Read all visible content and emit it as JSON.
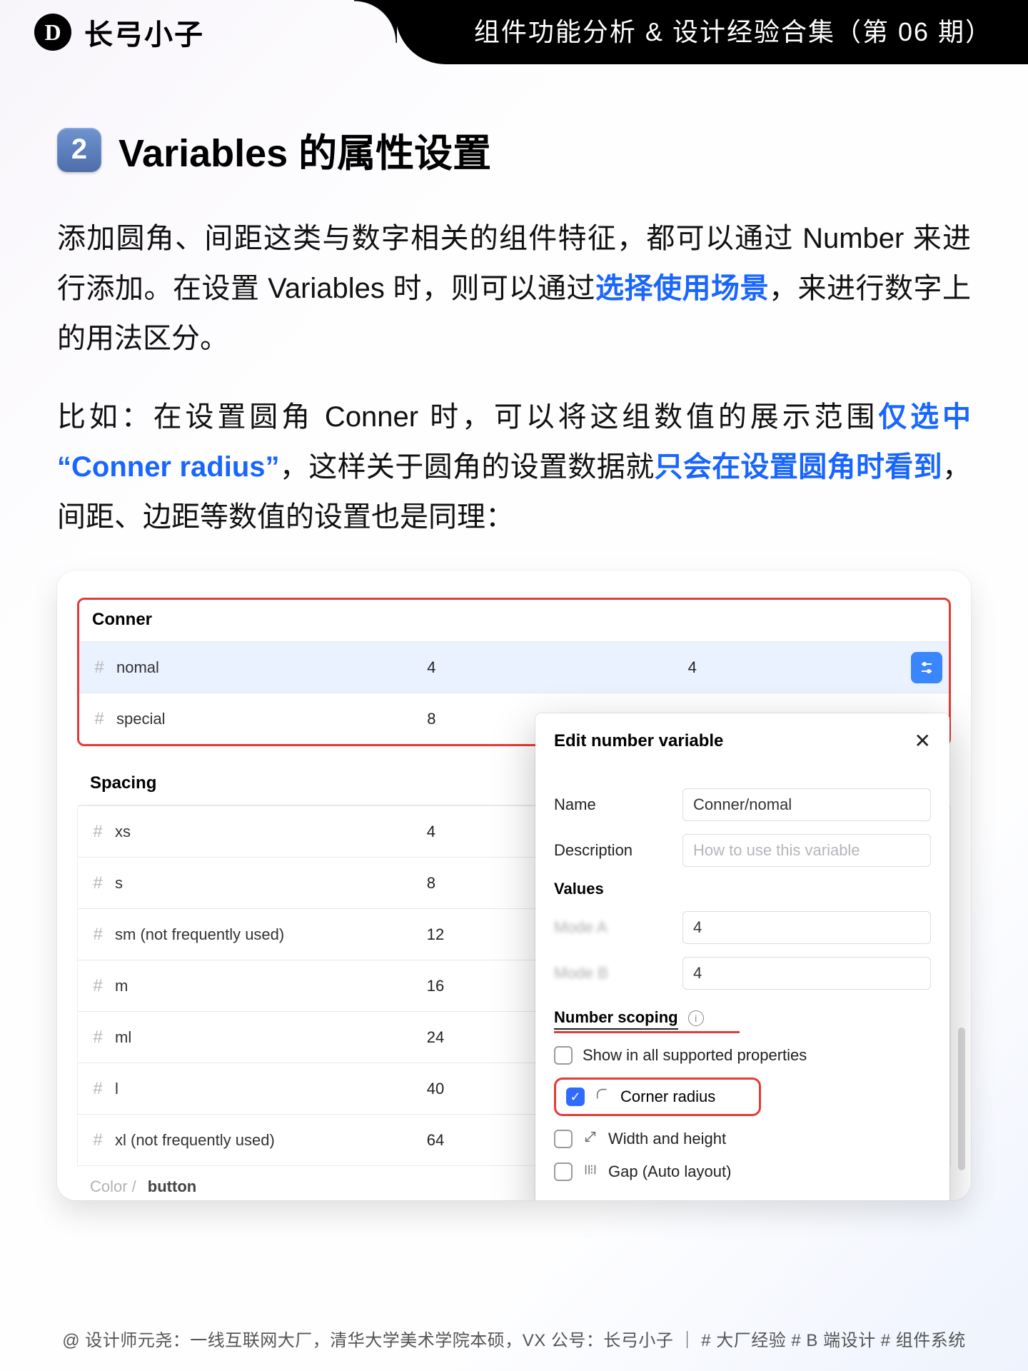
{
  "header": {
    "brand_initial": "D",
    "brand": "长弓小子",
    "pill": "组件功能分析 & 设计经验合集（第 06 期）"
  },
  "title": {
    "index": "2",
    "text": "Variables 的属性设置"
  },
  "para1": {
    "a": "添加圆角、间距这类与数字相关的组件特征，都可以通过 Number 来进行添加。在设置 Variables 时，则可以通过",
    "b": "选择使用场景",
    "c": "，来进行数字上的用法区分。"
  },
  "para2": {
    "a": "比如：在设置圆角 Conner 时，可以将这组数值的展示范围",
    "b": "仅选中 “Conner radius”",
    "c": "，这样关于圆角的设置数据就",
    "d": "只会在设置圆角时看到",
    "e": "，间距、边距等数值的设置也是同理："
  },
  "figma": {
    "conner_title": "Conner",
    "conner_rows": [
      {
        "name": "nomal",
        "v1": "4",
        "v2": "4",
        "selected": true
      },
      {
        "name": "special",
        "v1": "8",
        "v2": ""
      }
    ],
    "spacing_title": "Spacing",
    "spacing_rows": [
      {
        "name": "xs",
        "v1": "4"
      },
      {
        "name": "s",
        "v1": "8"
      },
      {
        "name": "sm (not frequently used)",
        "v1": "12"
      },
      {
        "name": "m",
        "v1": "16"
      },
      {
        "name": "ml",
        "v1": "24"
      },
      {
        "name": "l",
        "v1": "40"
      },
      {
        "name": "xl (not frequently used)",
        "v1": "64"
      }
    ],
    "ghost_prefix": "Color /",
    "ghost_bold": "button"
  },
  "popover": {
    "title": "Edit number variable",
    "name_lbl": "Name",
    "name_val": "Conner/nomal",
    "desc_lbl": "Description",
    "desc_placeholder": "How to use this variable",
    "values_title": "Values",
    "value_rows": [
      {
        "label": "blurred",
        "value": "4"
      },
      {
        "label": "blurred",
        "value": "4"
      }
    ],
    "scope_title": "Number scoping",
    "options": {
      "all": "Show in all supported properties",
      "corner": "Corner radius",
      "wh": "Width and height",
      "gap": "Gap (Auto layout)"
    }
  },
  "footer": "@ 设计师元尧：一线互联网大厂，清华大学美术学院本硕，VX 公号：长弓小子 ｜ # 大厂经验  # B 端设计  # 组件系统"
}
